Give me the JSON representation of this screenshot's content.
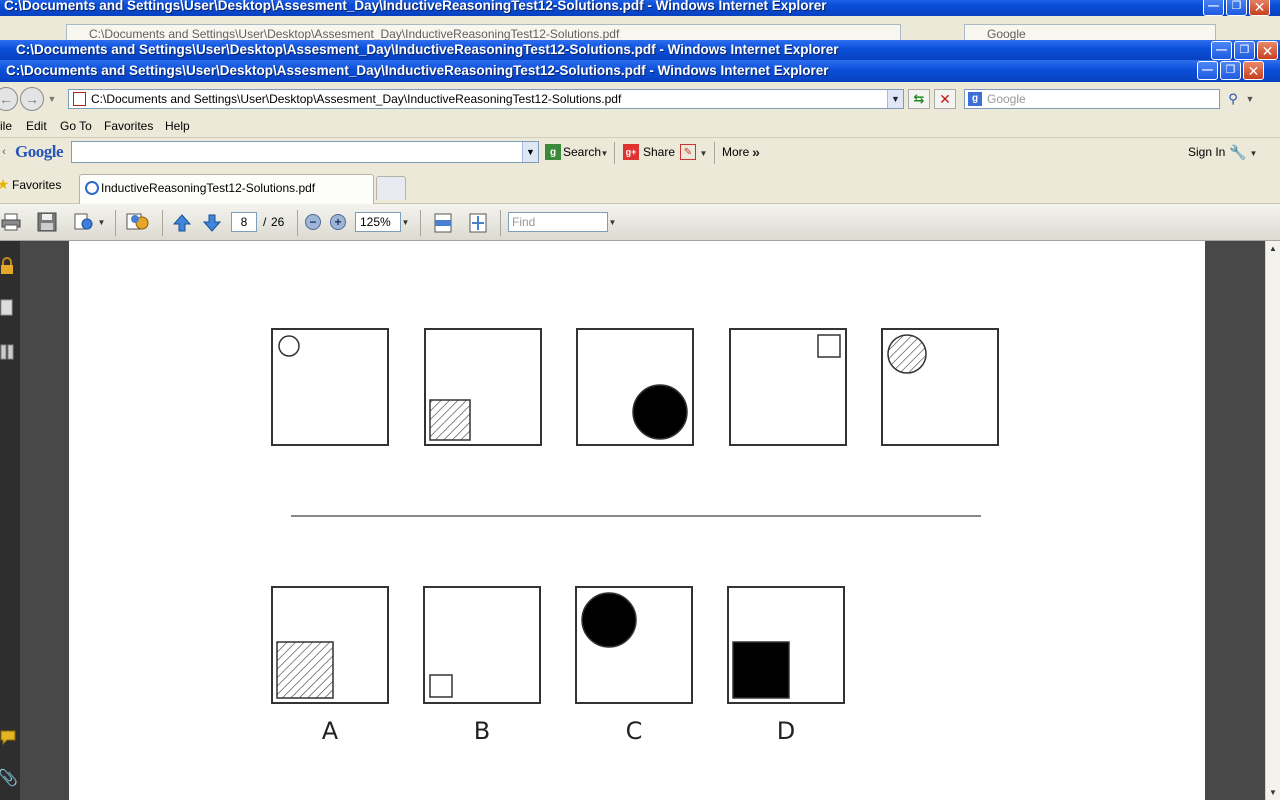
{
  "window": {
    "title": "C:\\Documents and Settings\\User\\Desktop\\Assesment_Day\\InductiveReasoningTest12-Solutions.pdf - Windows Internet Explorer",
    "behind_address": "C:\\Documents and Settings\\User\\Desktop\\Assesment_Day\\InductiveReasoningTest12-Solutions.pdf",
    "behind_search": "Google"
  },
  "address_bar": {
    "url": "C:\\Documents and Settings\\User\\Desktop\\Assesment_Day\\InductiveReasoningTest12-Solutions.pdf",
    "search_placeholder": "Google"
  },
  "menu": [
    "ile",
    "Edit",
    "Go To",
    "Favorites",
    "Help"
  ],
  "google_toolbar": {
    "logo": "Google",
    "search_label": "Search",
    "share_label": "Share",
    "more_label": "More",
    "sign_in": "Sign In"
  },
  "favorites_bar": {
    "favorites_label": "Favorites",
    "tab_title": "InductiveReasoningTest12-Solutions.pdf"
  },
  "pdf_toolbar": {
    "current_page": "8",
    "page_sep": "/",
    "total_pages": "26",
    "zoom": "125%",
    "find_placeholder": "Find"
  },
  "question": {
    "sequence": [
      {
        "shape": "circle",
        "fill": "empty",
        "size": "small",
        "corner": "top-left"
      },
      {
        "shape": "square",
        "fill": "hatched",
        "size": "medium",
        "corner": "bottom-left"
      },
      {
        "shape": "circle",
        "fill": "black",
        "size": "large",
        "corner": "bottom-right"
      },
      {
        "shape": "square",
        "fill": "empty",
        "size": "small",
        "corner": "top-right"
      },
      {
        "shape": "circle",
        "fill": "hatched",
        "size": "medium",
        "corner": "top-left"
      }
    ],
    "answers": [
      {
        "label": "A",
        "shape": "square",
        "fill": "hatched",
        "size": "large",
        "corner": "bottom-left"
      },
      {
        "label": "B",
        "shape": "square",
        "fill": "empty",
        "size": "small",
        "corner": "bottom-left"
      },
      {
        "label": "C",
        "shape": "circle",
        "fill": "black",
        "size": "large",
        "corner": "top-left"
      },
      {
        "label": "D",
        "shape": "square",
        "fill": "black",
        "size": "large",
        "corner": "bottom-left"
      }
    ]
  }
}
